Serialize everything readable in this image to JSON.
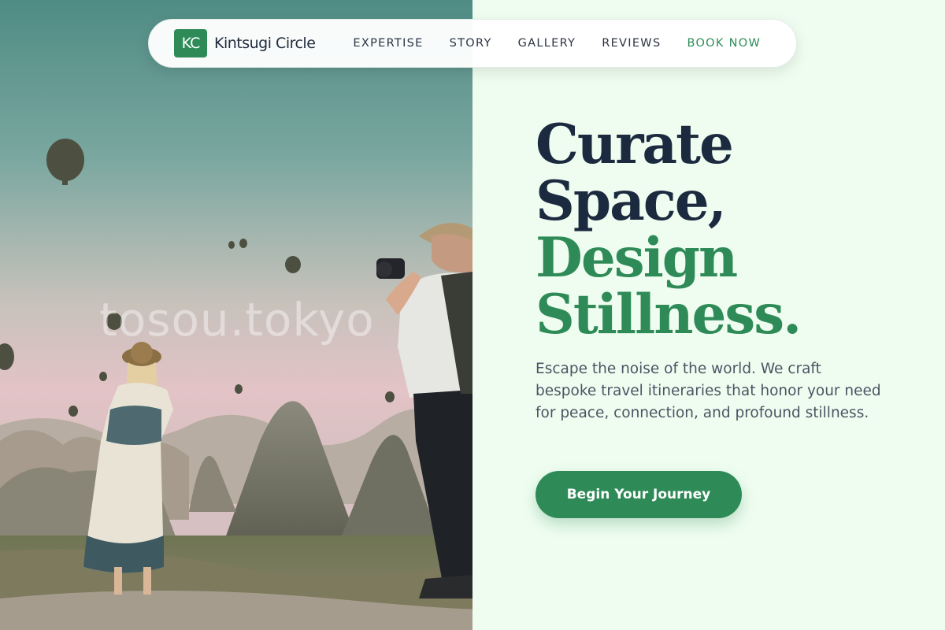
{
  "brand": {
    "logo_initials": "KC",
    "name": "Kintsugi Circle",
    "accent_color": "#2e8b57"
  },
  "nav": {
    "links": [
      "EXPERTISE",
      "STORY",
      "GALLERY",
      "REVIEWS"
    ],
    "cta": "BOOK NOW"
  },
  "hero": {
    "headline_line1": "Curate",
    "headline_line2": "Space,",
    "headline_line3": "Design",
    "headline_line4": "Stillness.",
    "subtitle": "Escape the noise of the world. We craft bespoke travel itineraries that honor your need for peace, connection, and profound stillness.",
    "button_label": "Begin Your Journey",
    "watermark": "tosou.tokyo",
    "image_subject": "hot-air-balloons-travelers-photo"
  }
}
